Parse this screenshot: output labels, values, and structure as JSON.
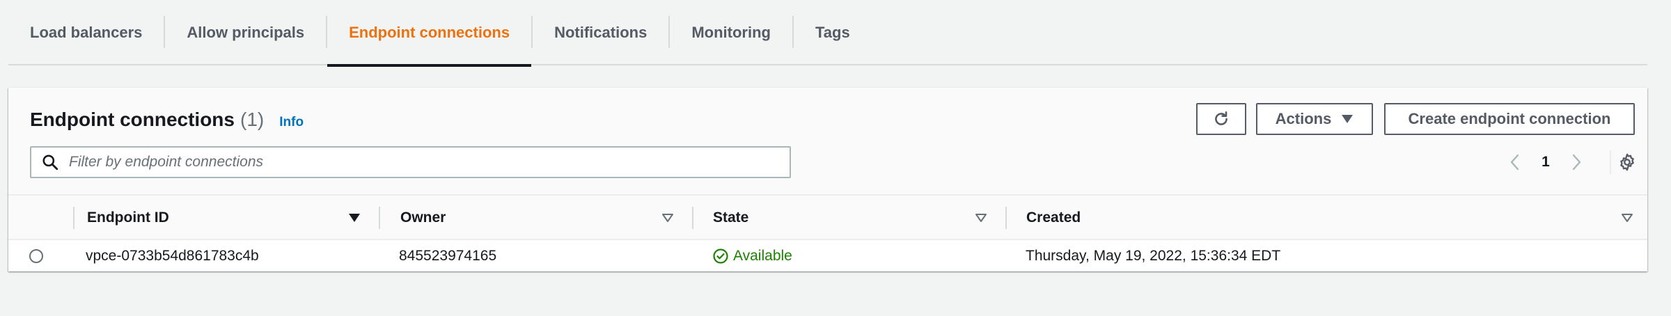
{
  "tabs": [
    {
      "label": "Load balancers",
      "active": false
    },
    {
      "label": "Allow principals",
      "active": false
    },
    {
      "label": "Endpoint connections",
      "active": true
    },
    {
      "label": "Notifications",
      "active": false
    },
    {
      "label": "Monitoring",
      "active": false
    },
    {
      "label": "Tags",
      "active": false
    }
  ],
  "panel": {
    "title": "Endpoint connections",
    "count": "(1)",
    "info_label": "Info",
    "actions_label": "Actions",
    "create_label": "Create endpoint connection",
    "search_placeholder": "Filter by endpoint connections",
    "page": "1"
  },
  "table": {
    "columns": [
      "Endpoint ID",
      "Owner",
      "State",
      "Created"
    ],
    "rows": [
      {
        "endpoint_id": "vpce-0733b54d861783c4b",
        "owner": "845523974165",
        "state": "Available",
        "created": "Thursday, May 19, 2022, 15:36:34 EDT"
      }
    ]
  },
  "colors": {
    "accent": "#ec7211",
    "link": "#0073bb",
    "success": "#1d8102",
    "text": "#16191f",
    "muted": "#545b64"
  }
}
